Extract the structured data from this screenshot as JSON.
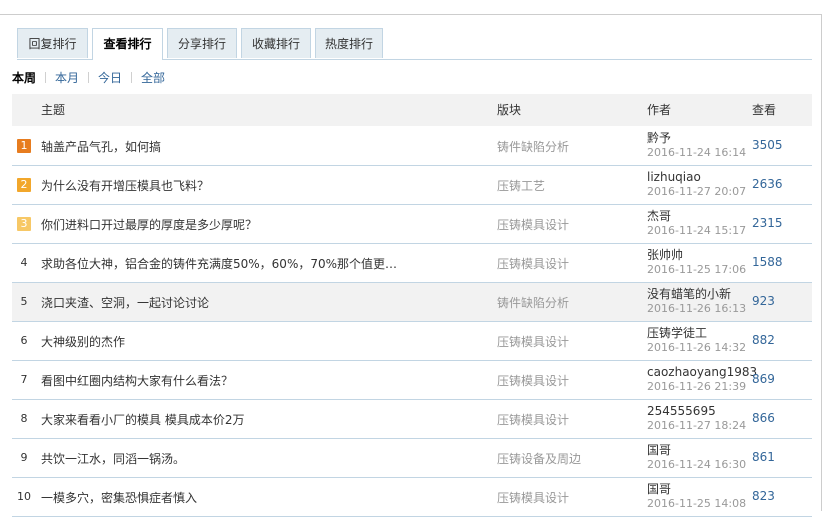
{
  "tabs": [
    "回复排行",
    "查看排行",
    "分享排行",
    "收藏排行",
    "热度排行"
  ],
  "active_tab": 1,
  "subtabs": [
    "本周",
    "本月",
    "今日",
    "全部"
  ],
  "active_subtab": 0,
  "headers": {
    "subject": "主题",
    "forum": "版块",
    "author": "作者",
    "views": "查看"
  },
  "rows": [
    {
      "rank": "1",
      "title": "轴盖产品气孔，如何搞",
      "forum": "铸件缺陷分析",
      "author": "黔予",
      "date": "2016-11-24 16:14",
      "views": "3505"
    },
    {
      "rank": "2",
      "title": "为什么没有开增压模具也飞料？",
      "forum": "压铸工艺",
      "author": "lizhuqiao",
      "date": "2016-11-27 20:07",
      "views": "2636"
    },
    {
      "rank": "3",
      "title": "你们进料口开过最厚的厚度是多少厚呢？",
      "forum": "压铸模具设计",
      "author": "杰哥",
      "date": "2016-11-24 15:17",
      "views": "2315"
    },
    {
      "rank": "4",
      "title": "求助各位大神，铝合金的铸件充满度50%，60%，70%那个值更…",
      "forum": "压铸模具设计",
      "author": "张帅帅",
      "date": "2016-11-25 17:06",
      "views": "1588"
    },
    {
      "rank": "5",
      "title": "浇口夹渣、空洞，一起讨论讨论",
      "forum": "铸件缺陷分析",
      "author": "没有蜡笔的小新",
      "date": "2016-11-26 16:13",
      "views": "923"
    },
    {
      "rank": "6",
      "title": "大神级别的杰作",
      "forum": "压铸模具设计",
      "author": "压铸学徒工",
      "date": "2016-11-26 14:32",
      "views": "882"
    },
    {
      "rank": "7",
      "title": "看图中红圈内结构大家有什么看法？",
      "forum": "压铸模具设计",
      "author": "caozhaoyang1983",
      "date": "2016-11-26 21:39",
      "views": "869"
    },
    {
      "rank": "8",
      "title": "大家来看看小厂的模具 模具成本价2万",
      "forum": "压铸模具设计",
      "author": "254555695",
      "date": "2016-11-27 18:24",
      "views": "866"
    },
    {
      "rank": "9",
      "title": "共饮一江水，同滔一锅汤。",
      "forum": "压铸设备及周边",
      "author": "国哥",
      "date": "2016-11-24 16:30",
      "views": "861"
    },
    {
      "rank": "10",
      "title": "一模多穴，密集恐惧症者慎入",
      "forum": "压铸模具设计",
      "author": "国哥",
      "date": "2016-11-25 14:08",
      "views": "823"
    }
  ]
}
